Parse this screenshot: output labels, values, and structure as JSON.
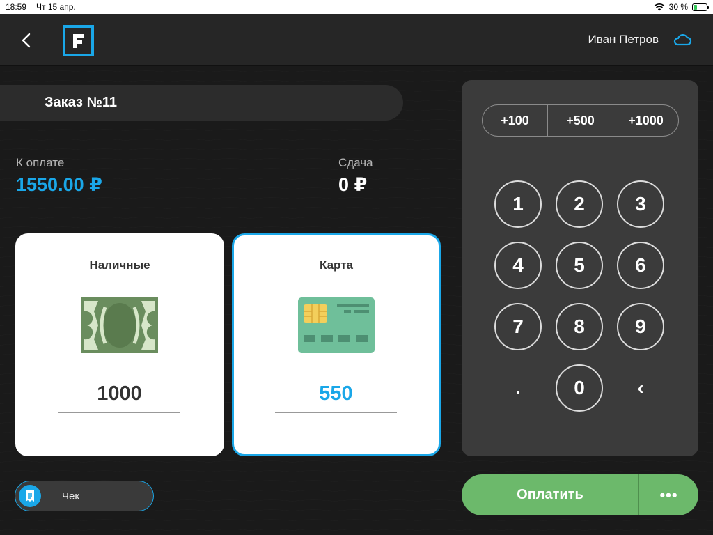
{
  "status_bar": {
    "time": "18:59",
    "date": "Чт 15 апр.",
    "battery": "30 %",
    "battery_level": 0.3
  },
  "header": {
    "user_name": "Иван Петров"
  },
  "order": {
    "title": "Заказ №11"
  },
  "summary": {
    "pay_label": "К оплате",
    "pay_amount": "1550.00 ₽",
    "change_label": "Сдача",
    "change_amount": "0 ₽"
  },
  "methods": {
    "cash": {
      "title": "Наличные",
      "value": "1000"
    },
    "card": {
      "title": "Карта",
      "value": "550"
    }
  },
  "receipt": {
    "label": "Чек"
  },
  "keypad": {
    "quick": [
      "+100",
      "+500",
      "+1000"
    ],
    "keys": [
      "1",
      "2",
      "3",
      "4",
      "5",
      "6",
      "7",
      "8",
      "9",
      ".",
      "0",
      "‹"
    ]
  },
  "actions": {
    "pay": "Оплатить",
    "more": "•••"
  },
  "colors": {
    "accent": "#1aa7e8",
    "pay_button": "#6cb96b"
  }
}
